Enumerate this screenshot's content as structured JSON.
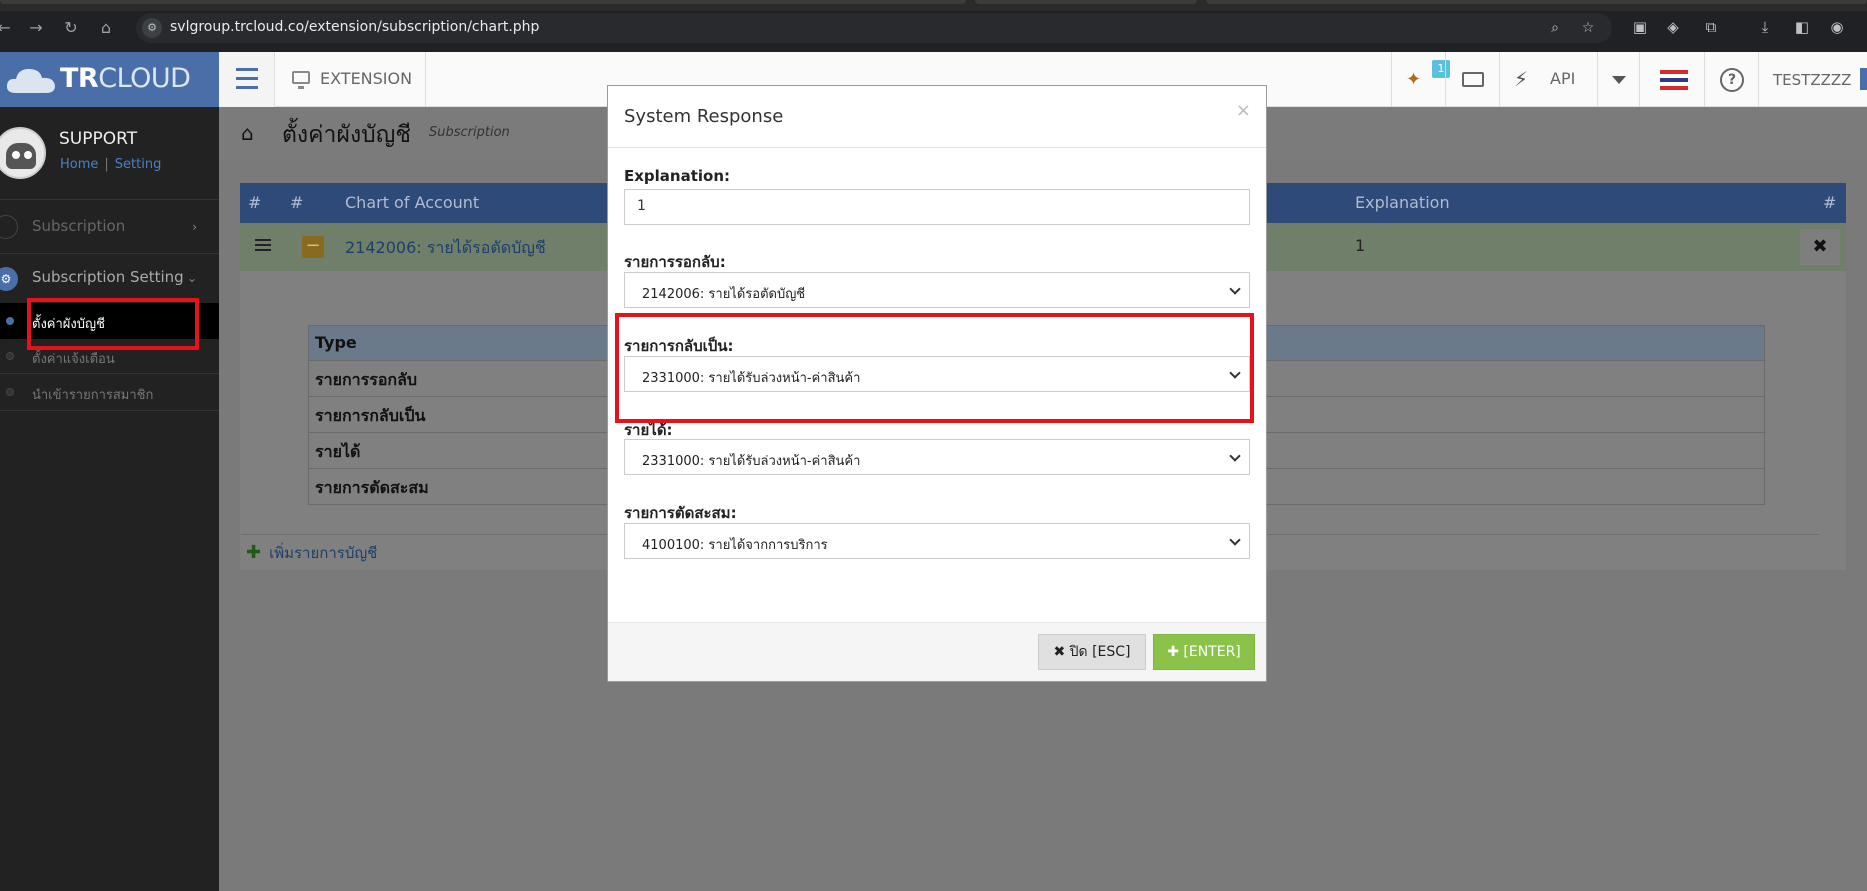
{
  "browser": {
    "url": "svlgroup.trcloud.co/extension/subscription/chart.php"
  },
  "header": {
    "logo_bold": "TR",
    "logo_light": "CLOUD",
    "extension_label": "EXTENSION",
    "notification_count": "1",
    "api_label": "API",
    "user_name": "TESTZZZZ"
  },
  "sidebar": {
    "user_name": "SUPPORT",
    "home_link": "Home",
    "link_sep": "|",
    "setting_link": "Setting",
    "menu": [
      {
        "label": "Subscription"
      },
      {
        "label": "Subscription Setting"
      }
    ],
    "sub_items": [
      {
        "label": "ตั้งค่าผังบัญชี"
      },
      {
        "label": "ตั้งค่าแจ้งเตือน"
      },
      {
        "label": "นำเข้ารายการสมาชิก"
      }
    ]
  },
  "page": {
    "title": "ตั้งค่าผังบัญชี",
    "subtitle": "Subscription",
    "grid_headers": [
      "#",
      "#",
      "Chart of Account",
      "Explanation",
      "#"
    ],
    "row": {
      "minus": "−",
      "account": "2142006: รายได้รอตัดบัญชี",
      "explanation": "1",
      "close": "✖"
    },
    "type_table": {
      "header": "Type",
      "rows": [
        "รายการรอกลับ",
        "รายการกลับเป็น",
        "รายได้",
        "รายการตัดสะสม"
      ]
    },
    "add_icon": "✚",
    "add_link": "เพิ่มรายการบัญชี"
  },
  "modal": {
    "title": "System Response",
    "close": "×",
    "explanation_label": "Explanation:",
    "explanation_value": "1",
    "fields": [
      {
        "label": "รายการรอกลับ:",
        "value": "2142006: รายได้รอตัดบัญชี"
      },
      {
        "label": "รายการกลับเป็น:",
        "value": "2331000: รายได้รับล่วงหน้า-ค่าสินค้า"
      },
      {
        "label": "รายได้:",
        "value": "2331000: รายได้รับล่วงหน้า-ค่าสินค้า"
      },
      {
        "label": "รายการตัดสะสม:",
        "value": "4100100: รายได้จากการบริการ"
      }
    ],
    "btn_close": "✖ ปิด [ESC]",
    "btn_enter": "✚ [ENTER]"
  },
  "colors": {
    "brand": "#4a6fa8",
    "highlight_box": "#e8101b",
    "enter_button": "#8bc34a"
  }
}
